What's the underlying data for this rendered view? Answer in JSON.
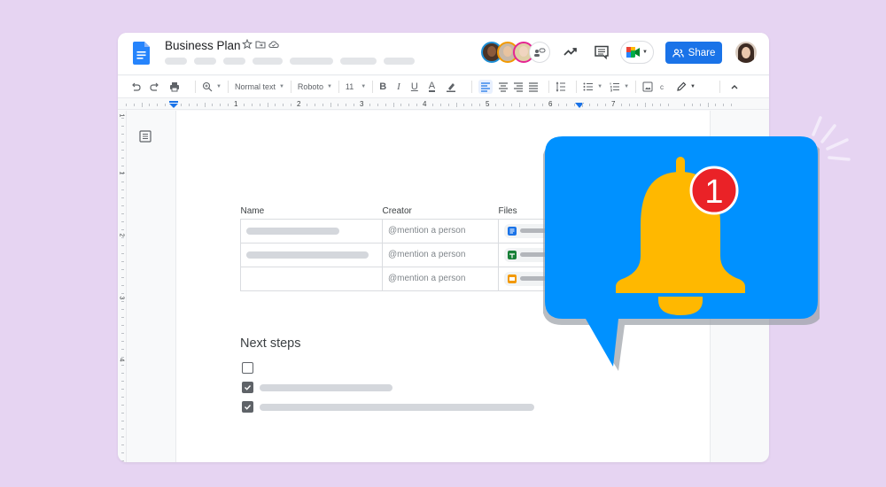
{
  "header": {
    "doc_title": "Business Plan",
    "title_icons": [
      "star-icon",
      "move-to-folder-icon",
      "cloud-saved-icon"
    ],
    "menu_placeholder_count": 8,
    "collaborators": [
      {
        "name": "collaborator-1",
        "ring_color": "#1e8fd6"
      },
      {
        "name": "collaborator-2",
        "ring_color": "#f29900"
      },
      {
        "name": "collaborator-3",
        "ring_color": "#e52592"
      }
    ],
    "share_label": "Share",
    "colors": {
      "share_bg": "#1a73e8"
    }
  },
  "toolbar": {
    "style_select": "Normal text",
    "font_select": "Roboto",
    "size_select": "11"
  },
  "ruler": {
    "h_labels": [
      "1",
      "2",
      "3",
      "4",
      "5",
      "6",
      "7"
    ],
    "v_labels": [
      "1",
      "1",
      "2",
      "3",
      "4"
    ]
  },
  "document": {
    "table": {
      "headers": [
        "Name",
        "Creator",
        "Files"
      ],
      "rows": [
        {
          "creator": "@mention a person",
          "file_type": "docs",
          "file_color": "#1a73e8"
        },
        {
          "creator": "@mention a person",
          "file_type": "sheets",
          "file_color": "#188038"
        },
        {
          "creator": "@mention a person",
          "file_type": "slides",
          "file_color": "#f29900"
        }
      ]
    },
    "next_steps_heading": "Next steps",
    "checklist": [
      {
        "checked": false
      },
      {
        "checked": true
      },
      {
        "checked": true
      }
    ]
  },
  "notification": {
    "count": "1",
    "colors": {
      "bubble": "#0091ff",
      "bell": "#ffb800",
      "badge": "#ea2227"
    }
  }
}
